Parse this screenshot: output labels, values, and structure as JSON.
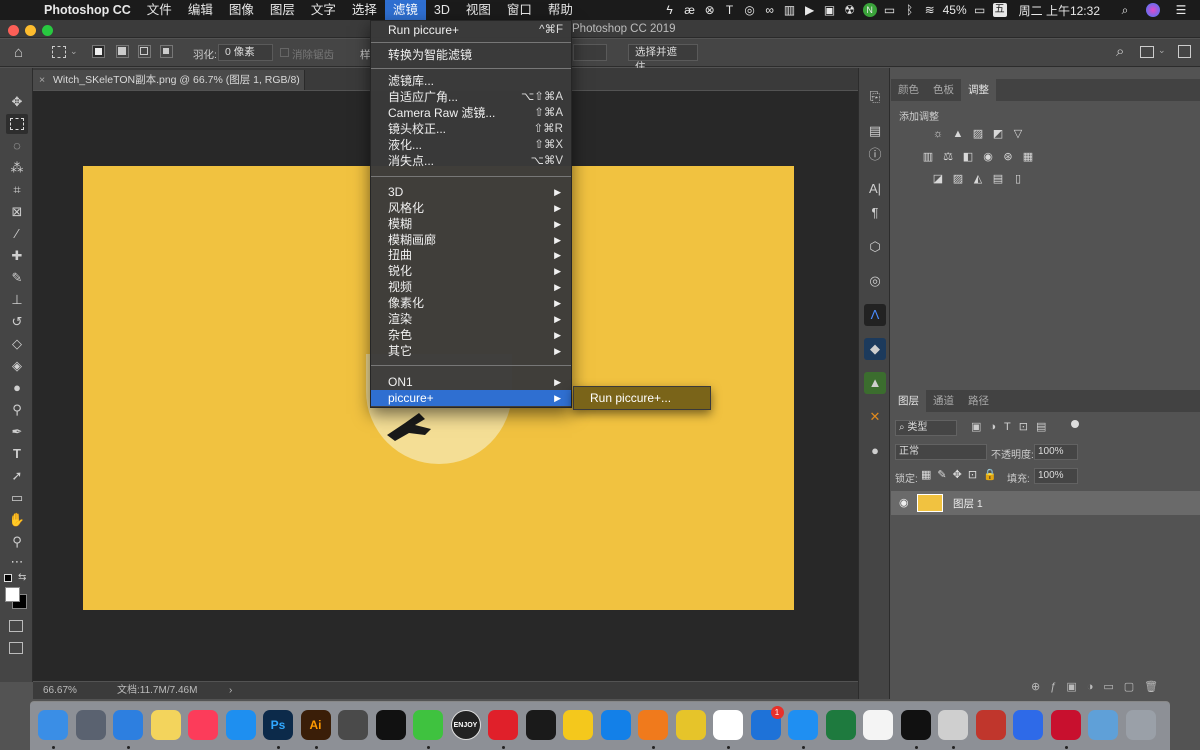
{
  "menubar": {
    "app_name": "Photoshop CC",
    "items": [
      "文件",
      "编辑",
      "图像",
      "图层",
      "文字",
      "选择",
      "滤镜",
      "3D",
      "视图",
      "窗口",
      "帮助"
    ],
    "active": "滤镜",
    "battery": "45%",
    "input_method": "五",
    "clock": "周二 上午12:32"
  },
  "window": {
    "title": "Photoshop CC 2019"
  },
  "options_bar": {
    "feather_label": "羽化:",
    "feather_value": "0 像素",
    "antialias_label": "消除锯齿",
    "style_label": "样",
    "select_mask_button": "选择并遮住..."
  },
  "document": {
    "tab_title": "Witch_SKeleTON副本.png @ 66.7% (图层 1, RGB/8)",
    "zoom": "66.67%",
    "doc_info": "文档:11.7M/7.46M",
    "artboard_color": "#f1c240"
  },
  "filter_menu": {
    "last_filter": "Run piccure+",
    "last_filter_shortcut": "^⌘F",
    "convert_smart": "转换为智能滤镜",
    "group1": [
      {
        "label": "滤镜库...",
        "shortcut": ""
      },
      {
        "label": "自适应广角...",
        "shortcut": "⌥⇧⌘A"
      },
      {
        "label": "Camera Raw 滤镜...",
        "shortcut": "⇧⌘A"
      },
      {
        "label": "镜头校正...",
        "shortcut": "⇧⌘R"
      },
      {
        "label": "液化...",
        "shortcut": "⇧⌘X"
      },
      {
        "label": "消失点...",
        "shortcut": "⌥⌘V"
      }
    ],
    "group2": [
      "3D",
      "风格化",
      "模糊",
      "模糊画廊",
      "扭曲",
      "锐化",
      "视频",
      "像素化",
      "渲染",
      "杂色",
      "其它"
    ],
    "group3": [
      "ON1",
      "piccure+"
    ],
    "highlighted": "piccure+",
    "submenu_item": "Run piccure+..."
  },
  "panels": {
    "top_tabs": [
      "颜色",
      "色板",
      "调整"
    ],
    "top_active": "调整",
    "add_adjustment": "添加调整",
    "layer_tabs": [
      "图层",
      "通道",
      "路径"
    ],
    "layer_active": "图层",
    "filter_kind": "类型",
    "blend_mode": "正常",
    "opacity_label": "不透明度:",
    "opacity_value": "100%",
    "lock_label": "锁定:",
    "fill_label": "填充:",
    "fill_value": "100%",
    "layer_name": "图层 1",
    "layer_thumb_color": "#f1c240"
  },
  "colors": {
    "menu_highlight": "#2f6fd1",
    "submenu_bg": "#7a6419"
  },
  "dock": {
    "apps": [
      "finder-icon",
      "launchpad-icon",
      "safari-icon",
      "notes-icon",
      "music-icon",
      "appstore-icon",
      "photoshop-icon",
      "illustrator-icon",
      "transmit-icon",
      "qq-icon",
      "wechat-icon",
      "enjoy-icon",
      "netease-music-icon",
      "player-icon",
      "live-icon",
      "teamviewer-icon",
      "sublime-icon",
      "yijiao-icon",
      "chrome-icon",
      "airmail-icon",
      "cloud-icon",
      "excel-icon",
      "textedit-icon",
      "terminal-icon",
      "preview-icon",
      "parallels-icon",
      "baidu-icon",
      "acrobat-icon",
      "downloads-folder-icon",
      "trash-icon"
    ],
    "photoshop_label": "Ps",
    "illustrator_label": "Ai",
    "enjoy_label": "ENJOY",
    "airmail_badge": "1"
  }
}
